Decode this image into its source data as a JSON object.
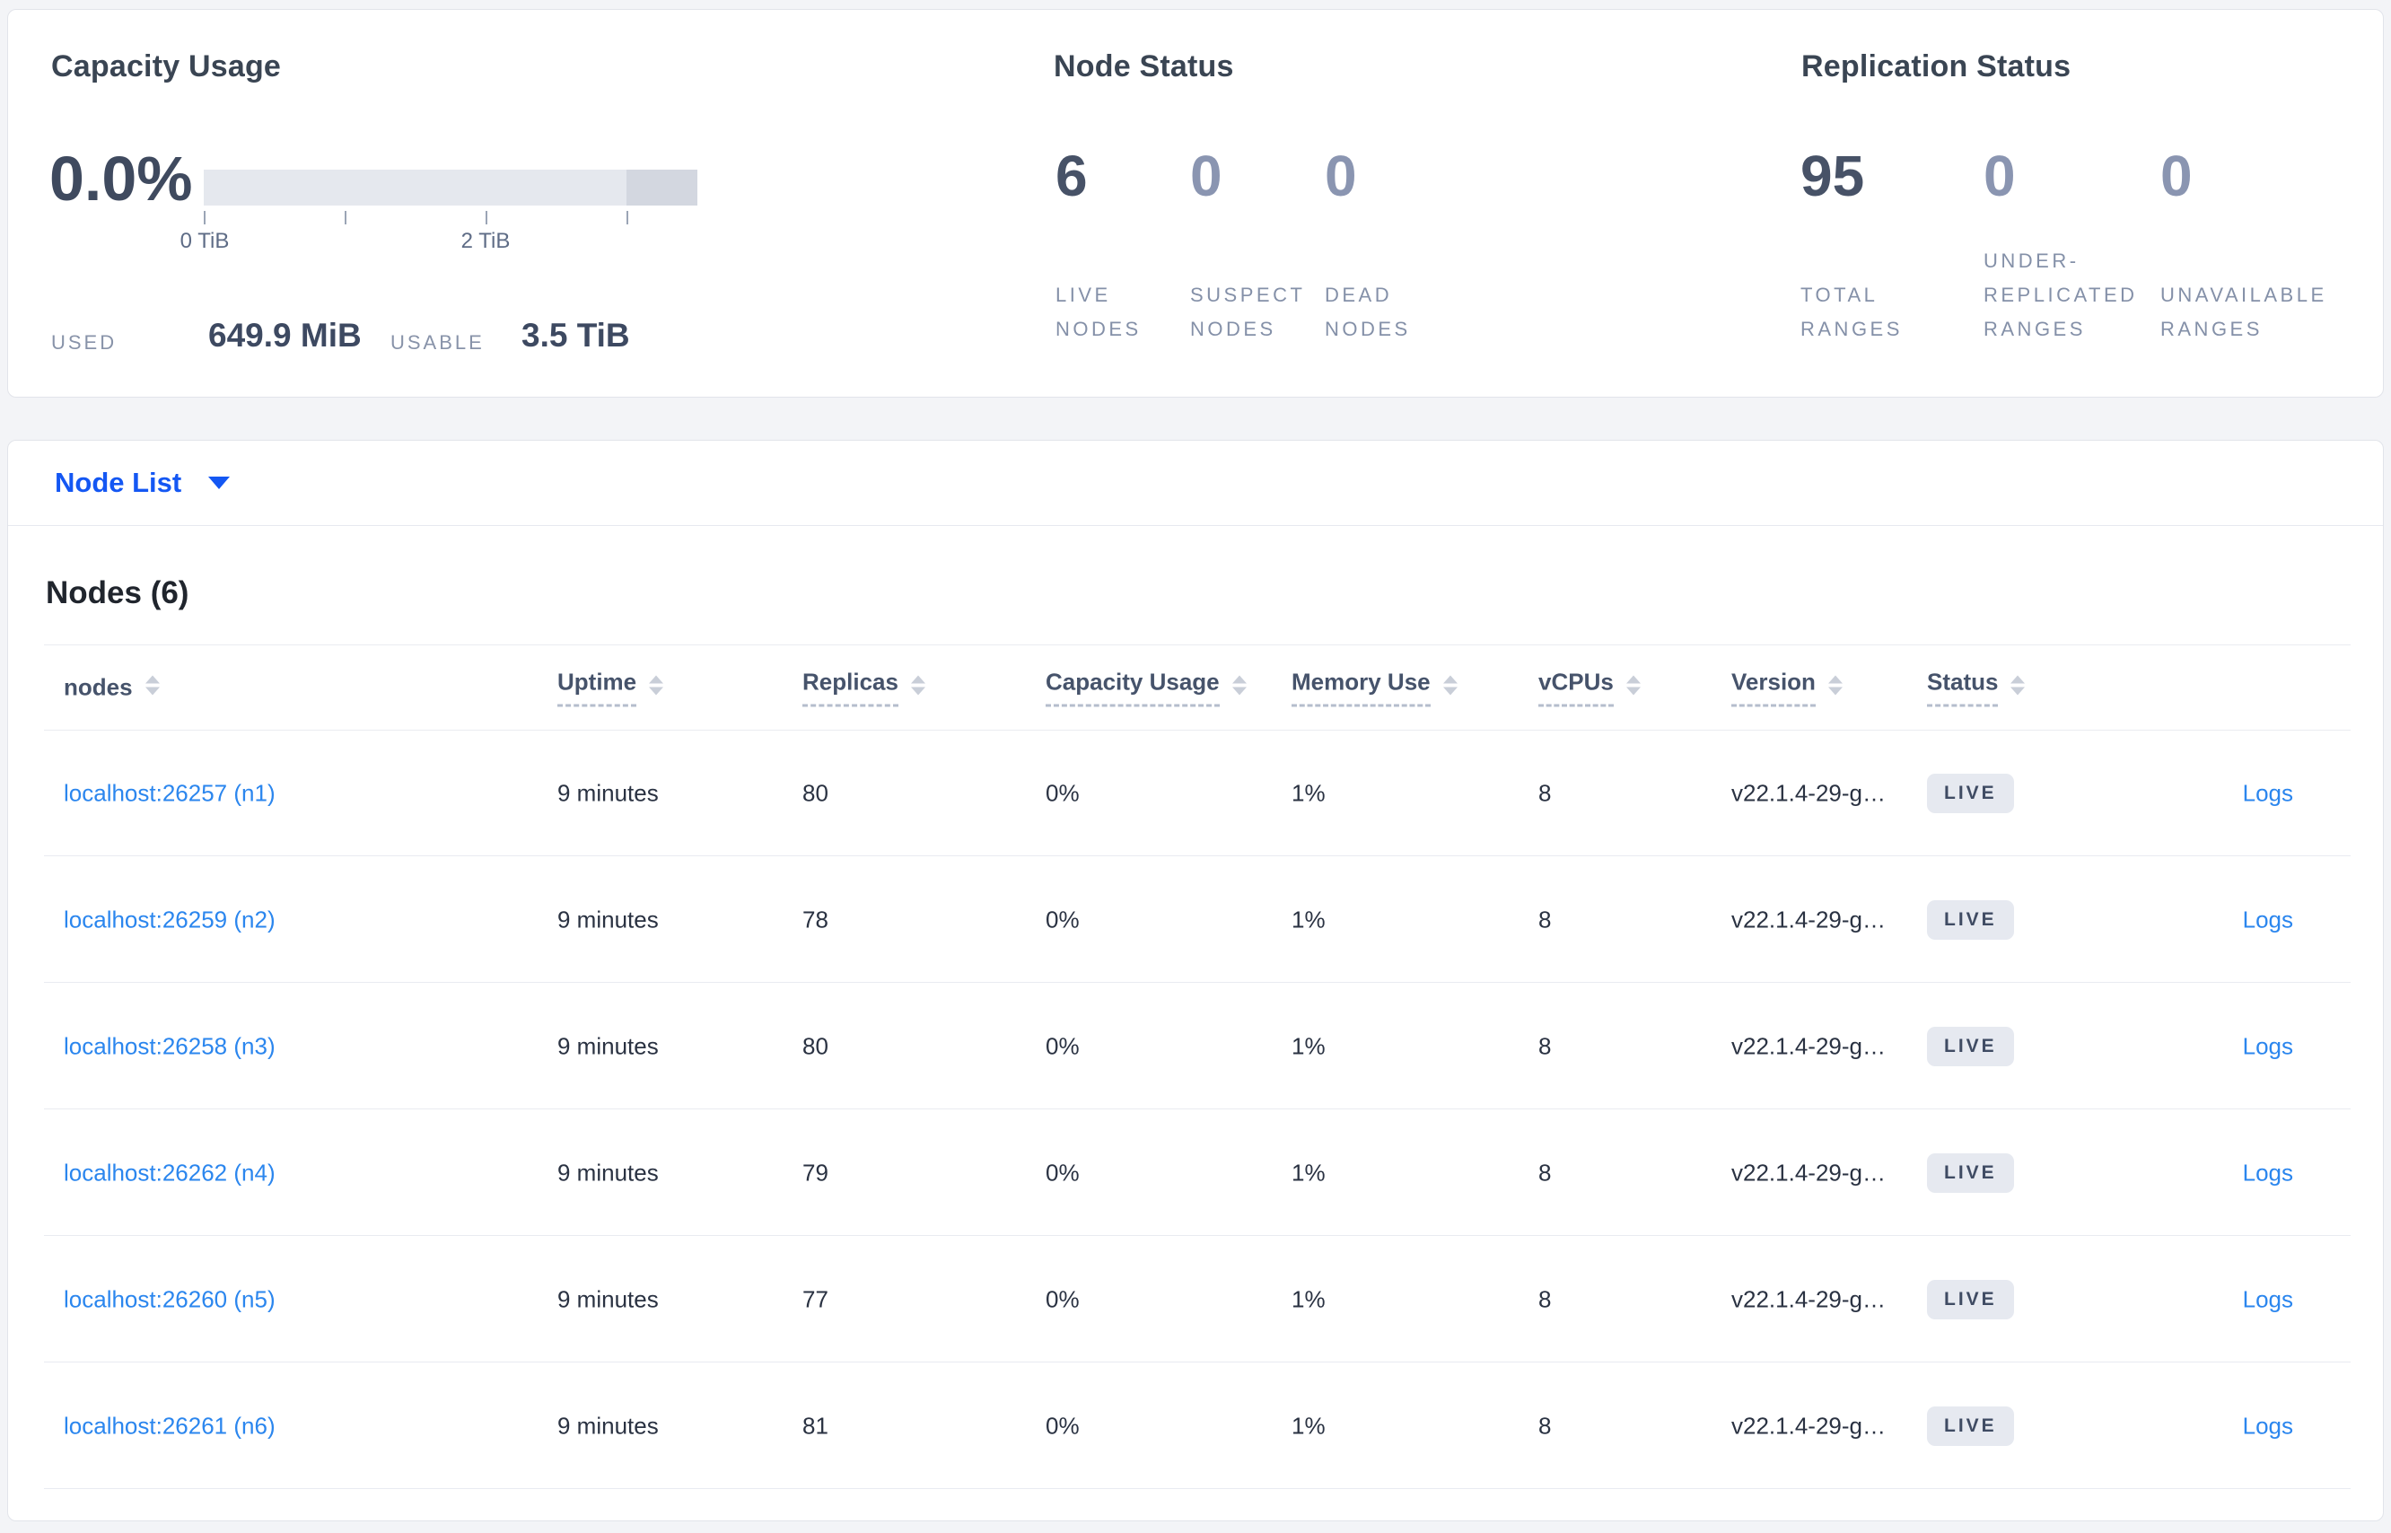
{
  "colors": {
    "page_background": "#f3f4f7",
    "card_background": "#ffffff",
    "card_border": "#e2e4ea",
    "selector_accent": "#1457f3",
    "link_blue": "#2b86ee",
    "bar_light": "#e5e8ee",
    "bar_dark": "#d3d7e0",
    "badge_background": "#e6e9f0",
    "stat_emphasis": "#475267",
    "stat_muted": "#8a95b1"
  },
  "summary": {
    "capacity": {
      "title": "Capacity Usage",
      "percent": "0.0%",
      "tick_labels": [
        "0 TiB",
        "2 TiB"
      ],
      "used_label": "USED",
      "used_value": "649.9 MiB",
      "usable_label": "USABLE",
      "usable_value": "3.5 TiB"
    },
    "node_status": {
      "title": "Node Status",
      "stats": [
        {
          "value": "6",
          "label": "LIVE NODES",
          "emphasis": true
        },
        {
          "value": "0",
          "label": "SUSPECT NODES",
          "emphasis": false
        },
        {
          "value": "0",
          "label": "DEAD NODES",
          "emphasis": false
        }
      ]
    },
    "replication_status": {
      "title": "Replication Status",
      "stats": [
        {
          "value": "95",
          "label": "TOTAL RANGES",
          "emphasis": true
        },
        {
          "value": "0",
          "label": "UNDER-REPLICATED RANGES",
          "emphasis": false
        },
        {
          "value": "0",
          "label": "UNAVAILABLE RANGES",
          "emphasis": false
        }
      ]
    }
  },
  "view_selector": {
    "label": "Node List"
  },
  "table": {
    "heading": "Nodes (6)",
    "columns": [
      {
        "label": "nodes",
        "dashed": false
      },
      {
        "label": "Uptime",
        "dashed": true
      },
      {
        "label": "Replicas",
        "dashed": true
      },
      {
        "label": "Capacity Usage",
        "dashed": true
      },
      {
        "label": "Memory Use",
        "dashed": true
      },
      {
        "label": "vCPUs",
        "dashed": true
      },
      {
        "label": "Version",
        "dashed": true
      },
      {
        "label": "Status",
        "dashed": true
      }
    ],
    "rows": [
      {
        "addr": "localhost:26257 (n1)",
        "uptime": "9 minutes",
        "replicas": "80",
        "capacity": "0%",
        "memory": "1%",
        "vcpus": "8",
        "version": "v22.1.4-29-g…",
        "status": "LIVE",
        "logs": "Logs"
      },
      {
        "addr": "localhost:26259 (n2)",
        "uptime": "9 minutes",
        "replicas": "78",
        "capacity": "0%",
        "memory": "1%",
        "vcpus": "8",
        "version": "v22.1.4-29-g…",
        "status": "LIVE",
        "logs": "Logs"
      },
      {
        "addr": "localhost:26258 (n3)",
        "uptime": "9 minutes",
        "replicas": "80",
        "capacity": "0%",
        "memory": "1%",
        "vcpus": "8",
        "version": "v22.1.4-29-g…",
        "status": "LIVE",
        "logs": "Logs"
      },
      {
        "addr": "localhost:26262 (n4)",
        "uptime": "9 minutes",
        "replicas": "79",
        "capacity": "0%",
        "memory": "1%",
        "vcpus": "8",
        "version": "v22.1.4-29-g…",
        "status": "LIVE",
        "logs": "Logs"
      },
      {
        "addr": "localhost:26260 (n5)",
        "uptime": "9 minutes",
        "replicas": "77",
        "capacity": "0%",
        "memory": "1%",
        "vcpus": "8",
        "version": "v22.1.4-29-g…",
        "status": "LIVE",
        "logs": "Logs"
      },
      {
        "addr": "localhost:26261 (n6)",
        "uptime": "9 minutes",
        "replicas": "81",
        "capacity": "0%",
        "memory": "1%",
        "vcpus": "8",
        "version": "v22.1.4-29-g…",
        "status": "LIVE",
        "logs": "Logs"
      }
    ]
  }
}
